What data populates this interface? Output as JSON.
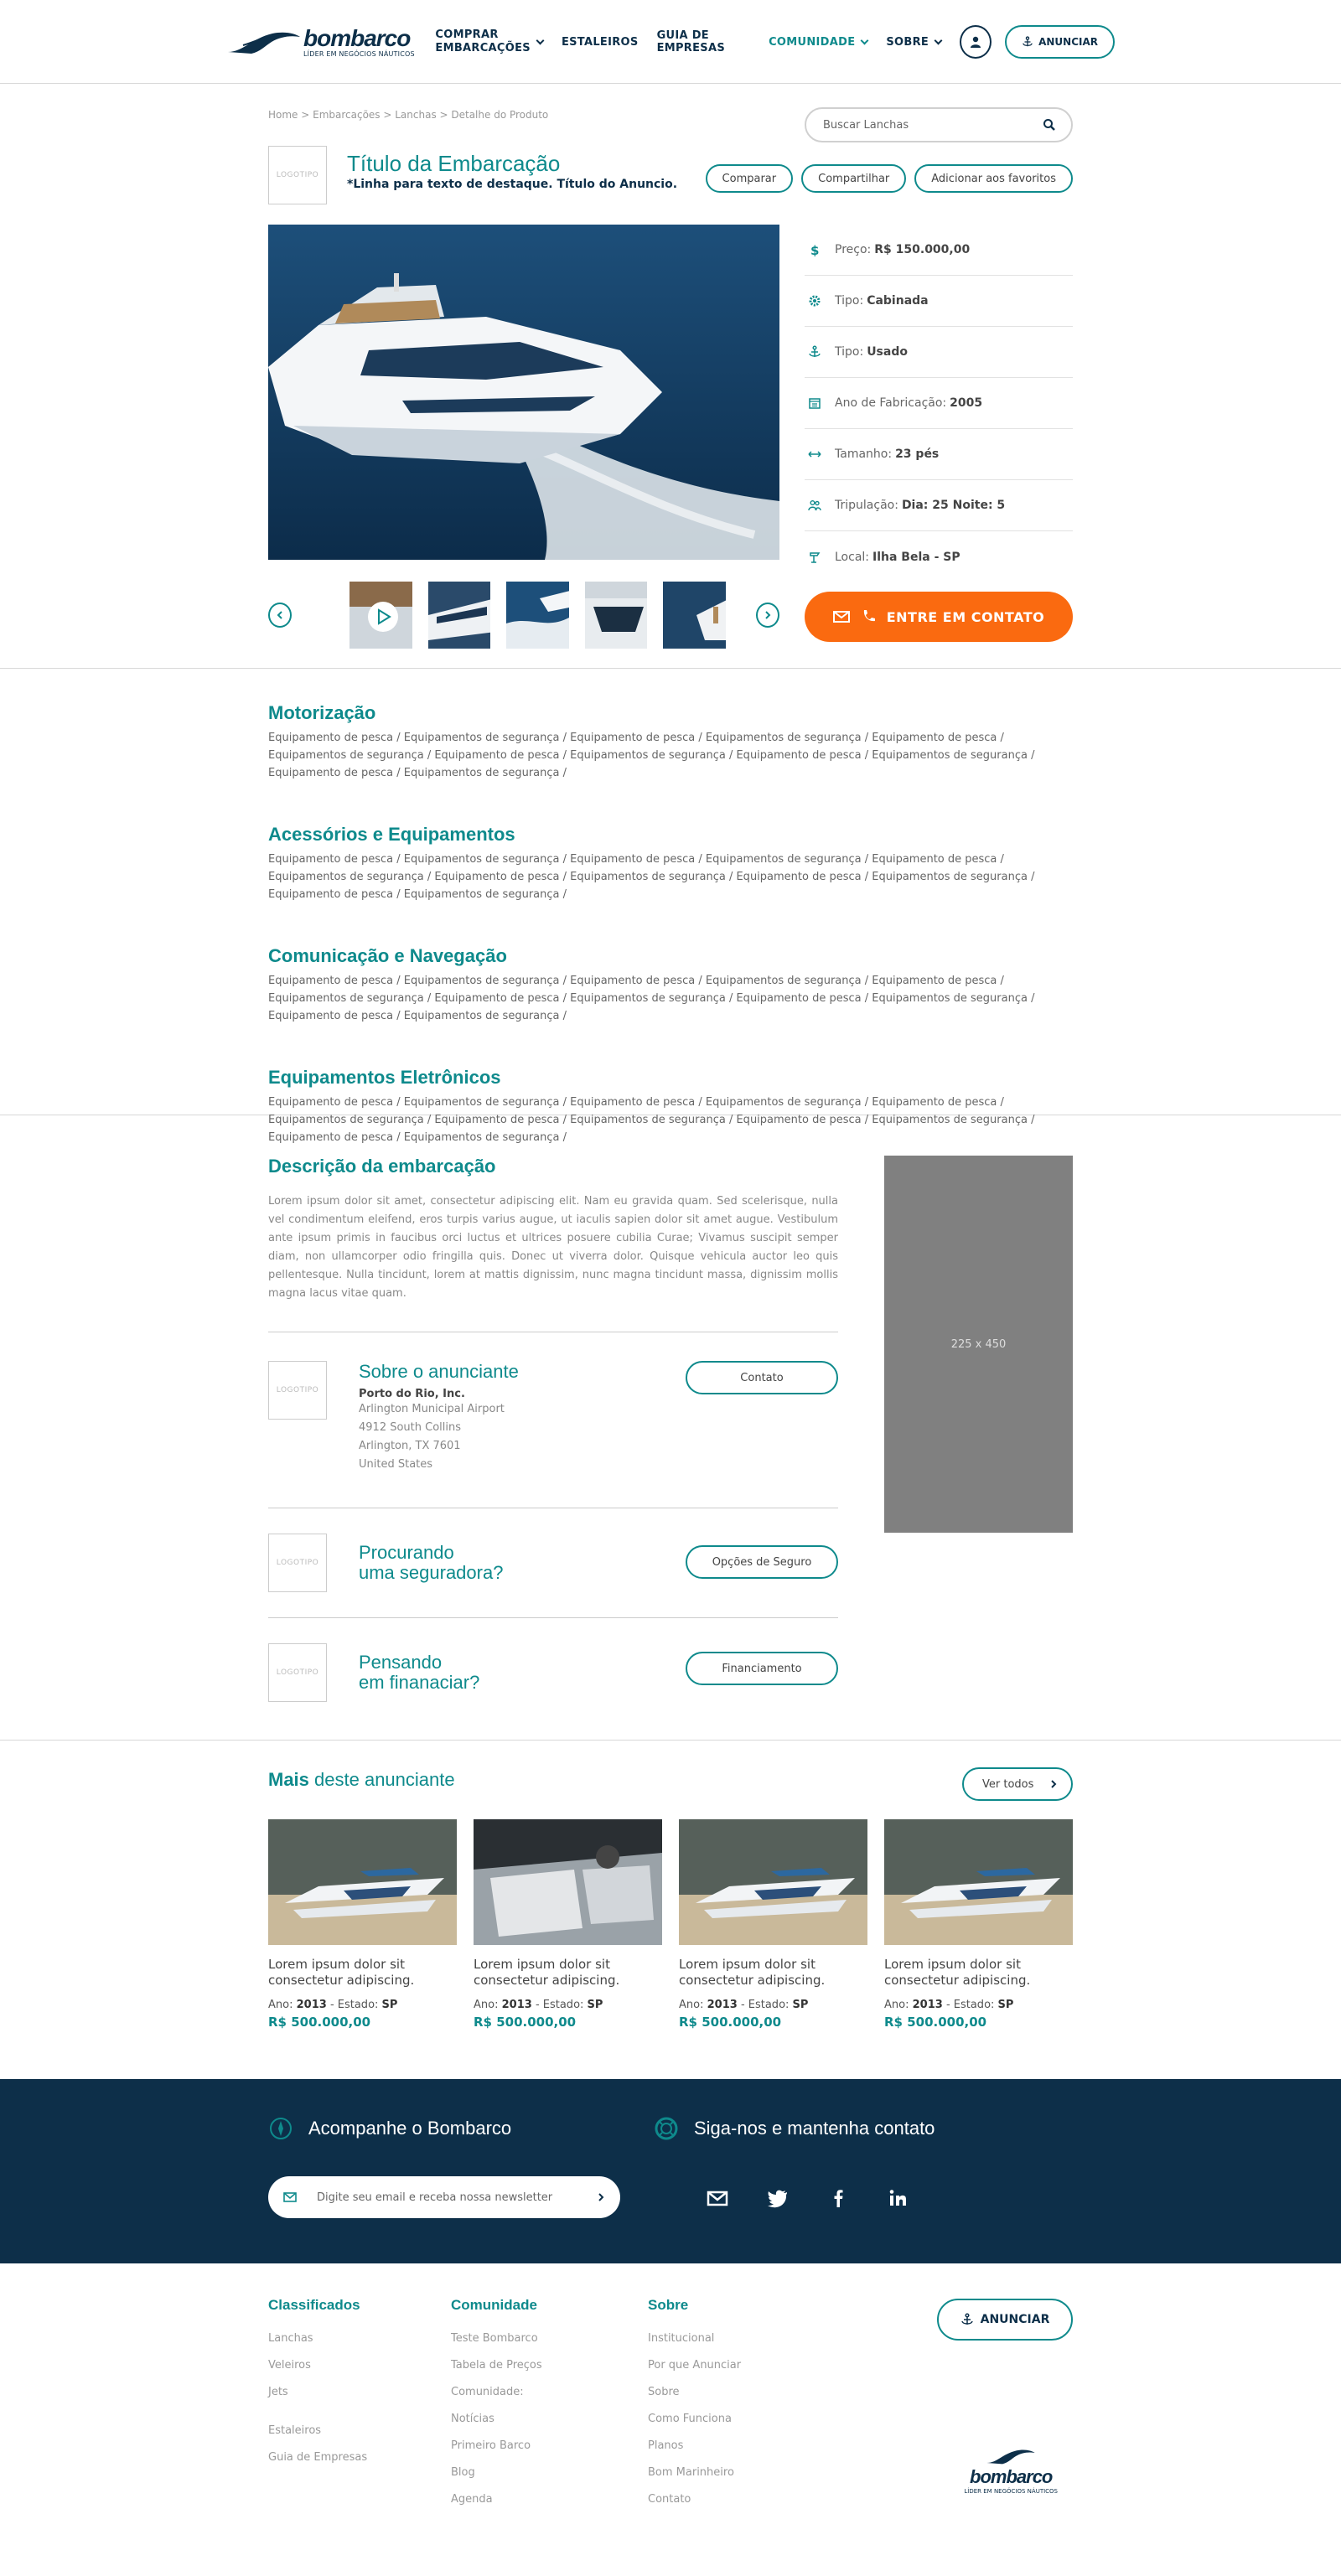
{
  "header": {
    "brand": "bombarco",
    "brand_tagline": "LÍDER EM NEGÓCIOS NÁUTICOS",
    "nav": [
      {
        "line1": "COMPRAR",
        "line2": "EMBARCAÇÕES"
      },
      {
        "label": "ESTALEIROS"
      },
      {
        "label": "GUIA DE EMPRESAS"
      },
      {
        "label": "COMUNIDADE"
      },
      {
        "label": "SOBRE"
      }
    ],
    "anunciar": "ANUNCIAR"
  },
  "breadcrumb": "Home > Embarcações > Lanchas > Detalhe do Produto",
  "search": {
    "placeholder": "Buscar Lanchas"
  },
  "product": {
    "logo_placeholder": "LOGOTIPO",
    "title": "Título da Embarcação",
    "subtitle": "*Linha para texto de destaque. Título do Anuncio.",
    "actions": [
      "Comparar",
      "Compartilhar",
      "Adicionar aos favoritos"
    ],
    "specs": [
      {
        "icon": "dollar-icon",
        "label": "Preço:",
        "value": "R$ 150.000,00"
      },
      {
        "icon": "gear-icon",
        "label": "Tipo:",
        "value": "Cabinada"
      },
      {
        "icon": "anchor-icon",
        "label": "Tipo:",
        "value": "Usado"
      },
      {
        "icon": "calendar-icon",
        "label": "Ano de Fabricação:",
        "value": "2005"
      },
      {
        "icon": "length-icon",
        "label": "Tamanho:",
        "value": "23 pés"
      },
      {
        "icon": "crew-icon",
        "label": "Tripulação:",
        "value": "Dia: 25 Noite: 5"
      },
      {
        "icon": "location-icon",
        "label": "Local:",
        "value": "Ilha Bela - SP"
      }
    ],
    "contact_button": "ENTRE EM CONTATO"
  },
  "features": [
    {
      "title": "Motorização",
      "text": "Equipamento de pesca / Equipamentos de segurança / Equipamento de pesca / Equipamentos de segurança / Equipamento de pesca / Equipamentos de segurança / Equipamento de pesca / Equipamentos de segurança / Equipamento de pesca / Equipamentos de segurança / Equipamento de pesca / Equipamentos de segurança /"
    },
    {
      "title": "Acessórios e Equipamentos",
      "text": "Equipamento de pesca / Equipamentos de segurança / Equipamento de pesca / Equipamentos de segurança / Equipamento de pesca / Equipamentos de segurança / Equipamento de pesca / Equipamentos de segurança / Equipamento de pesca / Equipamentos de segurança / Equipamento de pesca / Equipamentos de segurança /"
    },
    {
      "title": "Comunicação e Navegação",
      "text": "Equipamento de pesca / Equipamentos de segurança / Equipamento de pesca / Equipamentos de segurança / Equipamento de pesca / Equipamentos de segurança / Equipamento de pesca / Equipamentos de segurança / Equipamento de pesca / Equipamentos de segurança / Equipamento de pesca / Equipamentos de segurança /"
    },
    {
      "title": "Equipamentos Eletrônicos",
      "text": "Equipamento de pesca / Equipamentos de segurança / Equipamento de pesca / Equipamentos de segurança / Equipamento de pesca / Equipamentos de segurança / Equipamento de pesca / Equipamentos de segurança / Equipamento de pesca / Equipamentos de segurança / Equipamento de pesca / Equipamentos de segurança /"
    }
  ],
  "description": {
    "title": "Descrição da embarcação",
    "text": "Lorem ipsum dolor sit amet, consectetur adipiscing elit. Nam eu gravida quam. Sed scelerisque, nulla vel condimentum eleifend, eros turpis varius augue, ut iaculis sapien dolor sit amet augue. Vestibulum ante ipsum primis in faucibus orci luctus et ultrices posuere cubilia Curae; Vivamus suscipit semper diam, non ullamcorper odio fringilla quis. Donec ut viverra dolor. Quisque vehicula auctor leo quis pellentesque. Nulla tincidunt, lorem at mattis dignissim, nunc magna tincidunt massa, dignissim mollis magna lacus vitae quam."
  },
  "ad": {
    "label": "225 x 450"
  },
  "advertiser": {
    "title": "Sobre o anunciante",
    "name": "Porto do Rio, Inc.",
    "address": [
      "Arlington Municipal Airport",
      "4912 South Collins",
      "Arlington, TX 7601",
      "United States"
    ],
    "button": "Contato"
  },
  "insurance": {
    "line1": "Procurando",
    "line2": "uma seguradora?",
    "button": "Opções de Seguro"
  },
  "financing": {
    "line1": "Pensando",
    "line2": "em finanaciar?",
    "button": "Financiamento"
  },
  "more": {
    "title_bold": "Mais",
    "title_rest": " deste anunciante",
    "see_all": "Ver todos",
    "cards": [
      {
        "title": "Lorem ipsum dolor sit consectetur adipiscing.",
        "year_label": "Ano:",
        "year": "2013",
        "state_label": "- Estado:",
        "state": "SP",
        "price": "R$ 500.000,00"
      },
      {
        "title": "Lorem ipsum dolor sit consectetur adipiscing.",
        "year_label": "Ano:",
        "year": "2013",
        "state_label": "- Estado:",
        "state": "SP",
        "price": "R$ 500.000,00"
      },
      {
        "title": "Lorem ipsum dolor sit consectetur adipiscing.",
        "year_label": "Ano:",
        "year": "2013",
        "state_label": "- Estado:",
        "state": "SP",
        "price": "R$ 500.000,00"
      },
      {
        "title": "Lorem ipsum dolor sit consectetur adipiscing.",
        "year_label": "Ano:",
        "year": "2013",
        "state_label": "- Estado:",
        "state": "SP",
        "price": "R$ 500.000,00"
      }
    ]
  },
  "band": {
    "follow": "Acompanhe o Bombarco",
    "social": "Siga-nos e mantenha contato",
    "newsletter_placeholder": "Digite seu email e receba nossa newsletter"
  },
  "footer": {
    "classificados": {
      "title": "Classificados",
      "links": [
        "Lanchas",
        "Veleiros",
        "Jets",
        "Estaleiros",
        "Guia de Empresas"
      ]
    },
    "comunidade": {
      "title": "Comunidade",
      "links": [
        "Teste Bombarco",
        "Tabela de Preços",
        "Comunidade:",
        "Notícias",
        "Primeiro Barco",
        "Blog",
        "Agenda"
      ]
    },
    "sobre": {
      "title": "Sobre",
      "links": [
        "Institucional",
        "Por que Anunciar",
        "Sobre",
        "Como Funciona",
        "Planos",
        "Bom Marinheiro",
        "Contato"
      ]
    },
    "anunciar": "ANUNCIAR",
    "brand": "bombarco",
    "brand_tagline": "LÍDER EM NEGÓCIOS NÁUTICOS"
  }
}
